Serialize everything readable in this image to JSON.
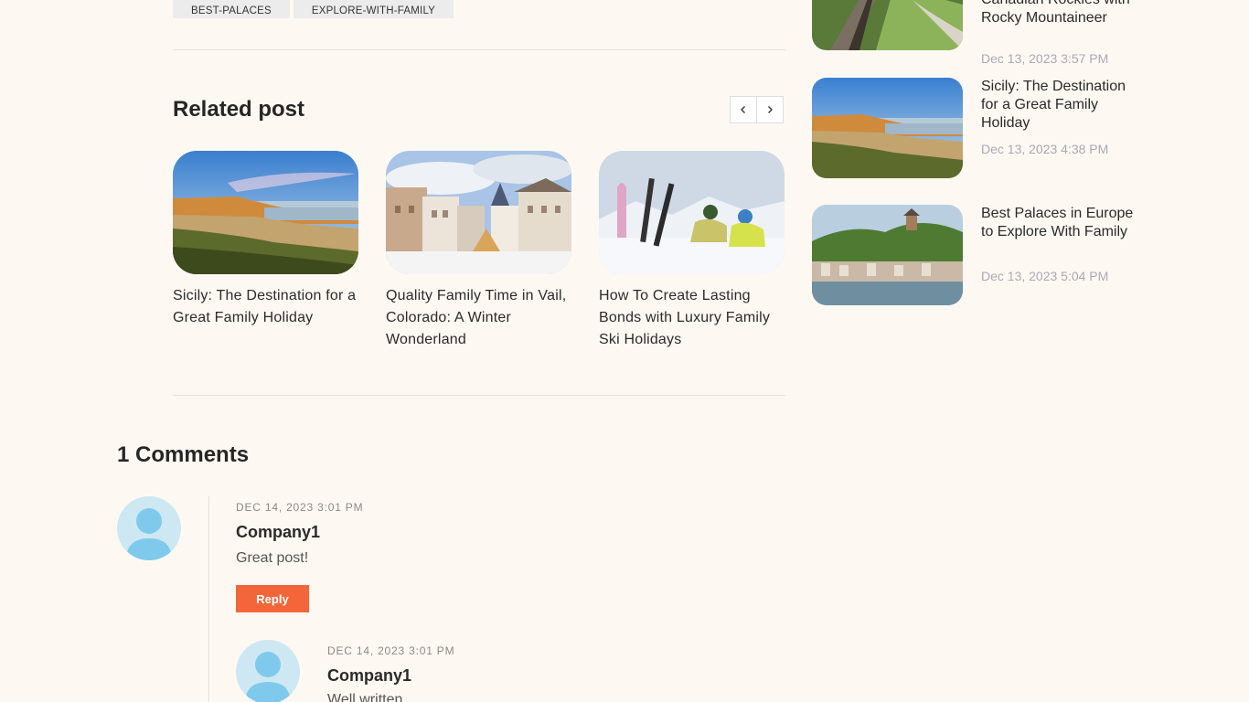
{
  "tags": [
    "BEST-PALACES",
    "EXPLORE-WITH-FAMILY"
  ],
  "related": {
    "title": "Related post",
    "posts": [
      {
        "title": "Sicily: The Destination for a Great Family Holiday"
      },
      {
        "title": "Quality Family Time in Vail, Colorado: A Winter Wonderland"
      },
      {
        "title": "How To Create Lasting Bonds with Luxury Family Ski Holidays"
      }
    ]
  },
  "comments": {
    "title": "1 Comments",
    "reply_label": "Reply",
    "items": [
      {
        "date": "DEC 14, 2023 3:01 PM",
        "author": "Company1",
        "text": "Great post!"
      },
      {
        "date": "DEC 14, 2023 3:01 PM",
        "author": "Company1",
        "text": "Well written"
      }
    ]
  },
  "sidebar": {
    "posts": [
      {
        "title": "Canadian Rockies with Rocky Mountaineer",
        "date": "Dec 13, 2023 3:57 PM"
      },
      {
        "title": "Sicily: The Destination for a Great Family Holiday",
        "date": "Dec 13, 2023 4:38 PM"
      },
      {
        "title": "Best Palaces in Europe to Explore With Family",
        "date": "Dec 13, 2023 5:04 PM"
      }
    ]
  },
  "colors": {
    "background": "#fdf9f2",
    "accent": "#f4663a",
    "date_muted": "#a9a9b6"
  },
  "icons": [
    "chevron-left-icon",
    "chevron-right-icon",
    "user-avatar-icon"
  ]
}
